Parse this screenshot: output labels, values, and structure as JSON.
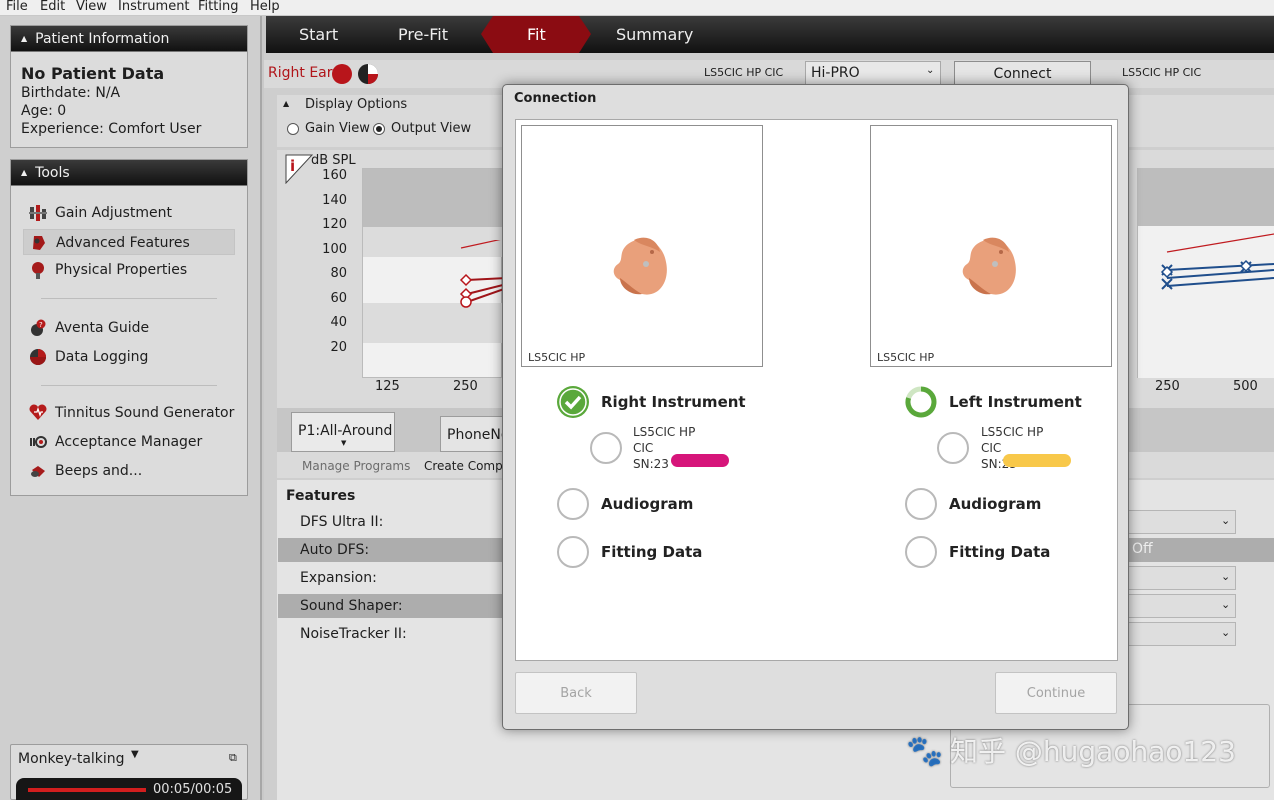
{
  "menu": [
    "File",
    "Edit",
    "View",
    "Instrument",
    "Fitting",
    "Help"
  ],
  "patient_panel": {
    "title": "Patient Information",
    "name": "No Patient Data",
    "birthdate": "Birthdate: N/A",
    "age": "Age: 0",
    "experience": "Experience: Comfort User"
  },
  "tools_panel": {
    "title": "Tools",
    "items": [
      {
        "label": "Gain Adjustment",
        "icon": "gain-adjustment-icon"
      },
      {
        "label": "Advanced Features",
        "icon": "advanced-features-icon"
      },
      {
        "label": "Physical Properties",
        "icon": "physical-properties-icon"
      },
      {
        "label": "Aventa Guide",
        "icon": "aventa-guide-icon"
      },
      {
        "label": "Data Logging",
        "icon": "data-logging-icon"
      },
      {
        "label": "Tinnitus Sound Generator",
        "icon": "tinnitus-icon"
      },
      {
        "label": "Acceptance Manager",
        "icon": "acceptance-manager-icon"
      },
      {
        "label": "Beeps and...",
        "icon": "beeps-icon"
      }
    ]
  },
  "player": {
    "title": "Monkey-talking",
    "time": "00:05/00:05",
    "progress": 1.0
  },
  "tabs": [
    "Start",
    "Pre-Fit",
    "Fit",
    "Summary"
  ],
  "active_tab": "Fit",
  "ear_bar": {
    "ear": "Right Ear",
    "model_right": "LS5CIC HP CIC",
    "interface": "Hi-PRO",
    "connect": "Connect",
    "model_left": "LS5CIC HP CIC"
  },
  "display_options": {
    "title": "Display Options",
    "gain_view": "Gain View",
    "output_view": "Output View",
    "selected": "Output View"
  },
  "graph": {
    "unit": "dB SPL",
    "y_ticks": [
      "160",
      "140",
      "120",
      "100",
      "80",
      "60",
      "40",
      "20"
    ],
    "x_ticks_right": [
      "125",
      "250"
    ],
    "x_ticks_left": [
      "250",
      "500"
    ]
  },
  "programs": {
    "p1": "P1:All-Around",
    "p2": "PhoneNo",
    "manage": "Manage Programs",
    "create": "Create Compar"
  },
  "features": {
    "title": "Features",
    "items": [
      "DFS Ultra II:",
      "Auto DFS:",
      "Expansion:",
      "Sound Shaper:",
      "NoiseTracker II:"
    ],
    "auto_dfs_value": "Off"
  },
  "dialog": {
    "title": "Connection",
    "back": "Back",
    "continue": "Continue",
    "right": {
      "image_caption": "LS5CIC HP",
      "instrument": "Right Instrument",
      "model": "LS5CIC HP",
      "style": "CIC",
      "sn": "SN:23",
      "audiogram": "Audiogram",
      "fitting_data": "Fitting Data",
      "status": "done"
    },
    "left": {
      "image_caption": "LS5CIC HP",
      "instrument": "Left Instrument",
      "model": "LS5CIC HP",
      "style": "CIC",
      "sn": "SN:23",
      "audiogram": "Audiogram",
      "fitting_data": "Fitting Data",
      "status": "loading"
    }
  },
  "watermark": "知乎 @hugaohao123",
  "colors": {
    "accent_red": "#b8151b",
    "check_green": "#5aa83b",
    "highlight_pink": "#d6157a",
    "highlight_yellow": "#f8c84a"
  }
}
